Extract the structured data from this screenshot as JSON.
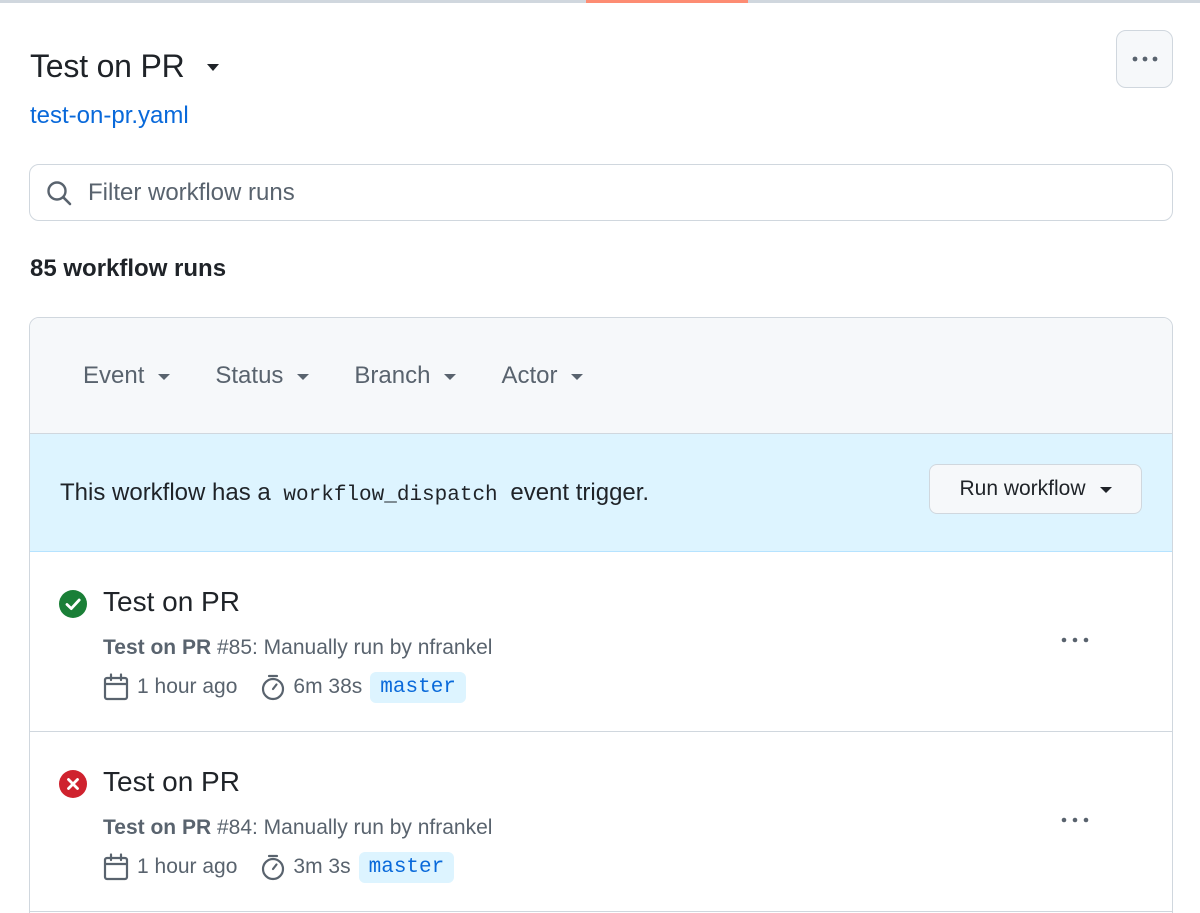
{
  "header": {
    "workflow_title": "Test on PR",
    "file_link": "test-on-pr.yaml"
  },
  "search": {
    "placeholder": "Filter workflow runs",
    "value": ""
  },
  "run_count": "85 workflow runs",
  "filters": [
    {
      "label": "Event"
    },
    {
      "label": "Status"
    },
    {
      "label": "Branch"
    },
    {
      "label": "Actor"
    }
  ],
  "dispatch_banner": {
    "text_before": "This workflow has a",
    "code": "workflow_dispatch",
    "text_after": "event trigger.",
    "button_label": "Run workflow"
  },
  "runs": [
    {
      "status": "success",
      "status_color": "#1a7f37",
      "title": "Test on PR",
      "workflow_name": "Test on PR",
      "detail": "#85: Manually run by nfrankel",
      "time_ago": "1 hour ago",
      "duration": "6m 38s",
      "branch": "master"
    },
    {
      "status": "failure",
      "status_color": "#cf222e",
      "title": "Test on PR",
      "workflow_name": "Test on PR",
      "detail": "#84: Manually run by nfrankel",
      "time_ago": "1 hour ago",
      "duration": "3m 3s",
      "branch": "master"
    }
  ],
  "colors": {
    "accent_link": "#0969da",
    "banner_bg": "#ddf4ff",
    "tab_underline": "#fd8c73"
  }
}
